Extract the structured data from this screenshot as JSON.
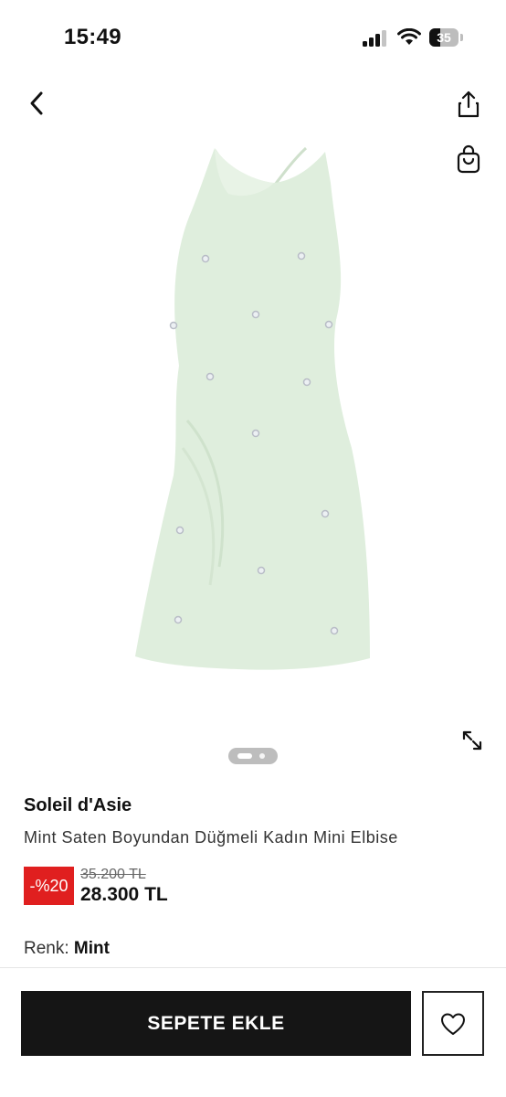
{
  "status_bar": {
    "time": "15:49",
    "battery_level": "35"
  },
  "icons": {
    "back": "chevron-left-icon",
    "share": "share-icon",
    "bag": "shopping-bag-icon",
    "expand": "expand-icon",
    "favorite": "heart-icon"
  },
  "gallery": {
    "image_count": 2,
    "active_index": 0,
    "dress_color": "#dfeedd"
  },
  "product": {
    "brand": "Soleil d'Asie",
    "name": "Mint Saten Boyundan Düğmeli Kadın Mini Elbise",
    "discount": "-%20",
    "old_price": "35.200 TL",
    "price": "28.300 TL",
    "color_label": "Renk:",
    "color_value": "Mint"
  },
  "actions": {
    "add_to_cart": "SEPETE EKLE"
  },
  "colors": {
    "discount_red": "#e01f1f",
    "button_dark": "#151515"
  }
}
